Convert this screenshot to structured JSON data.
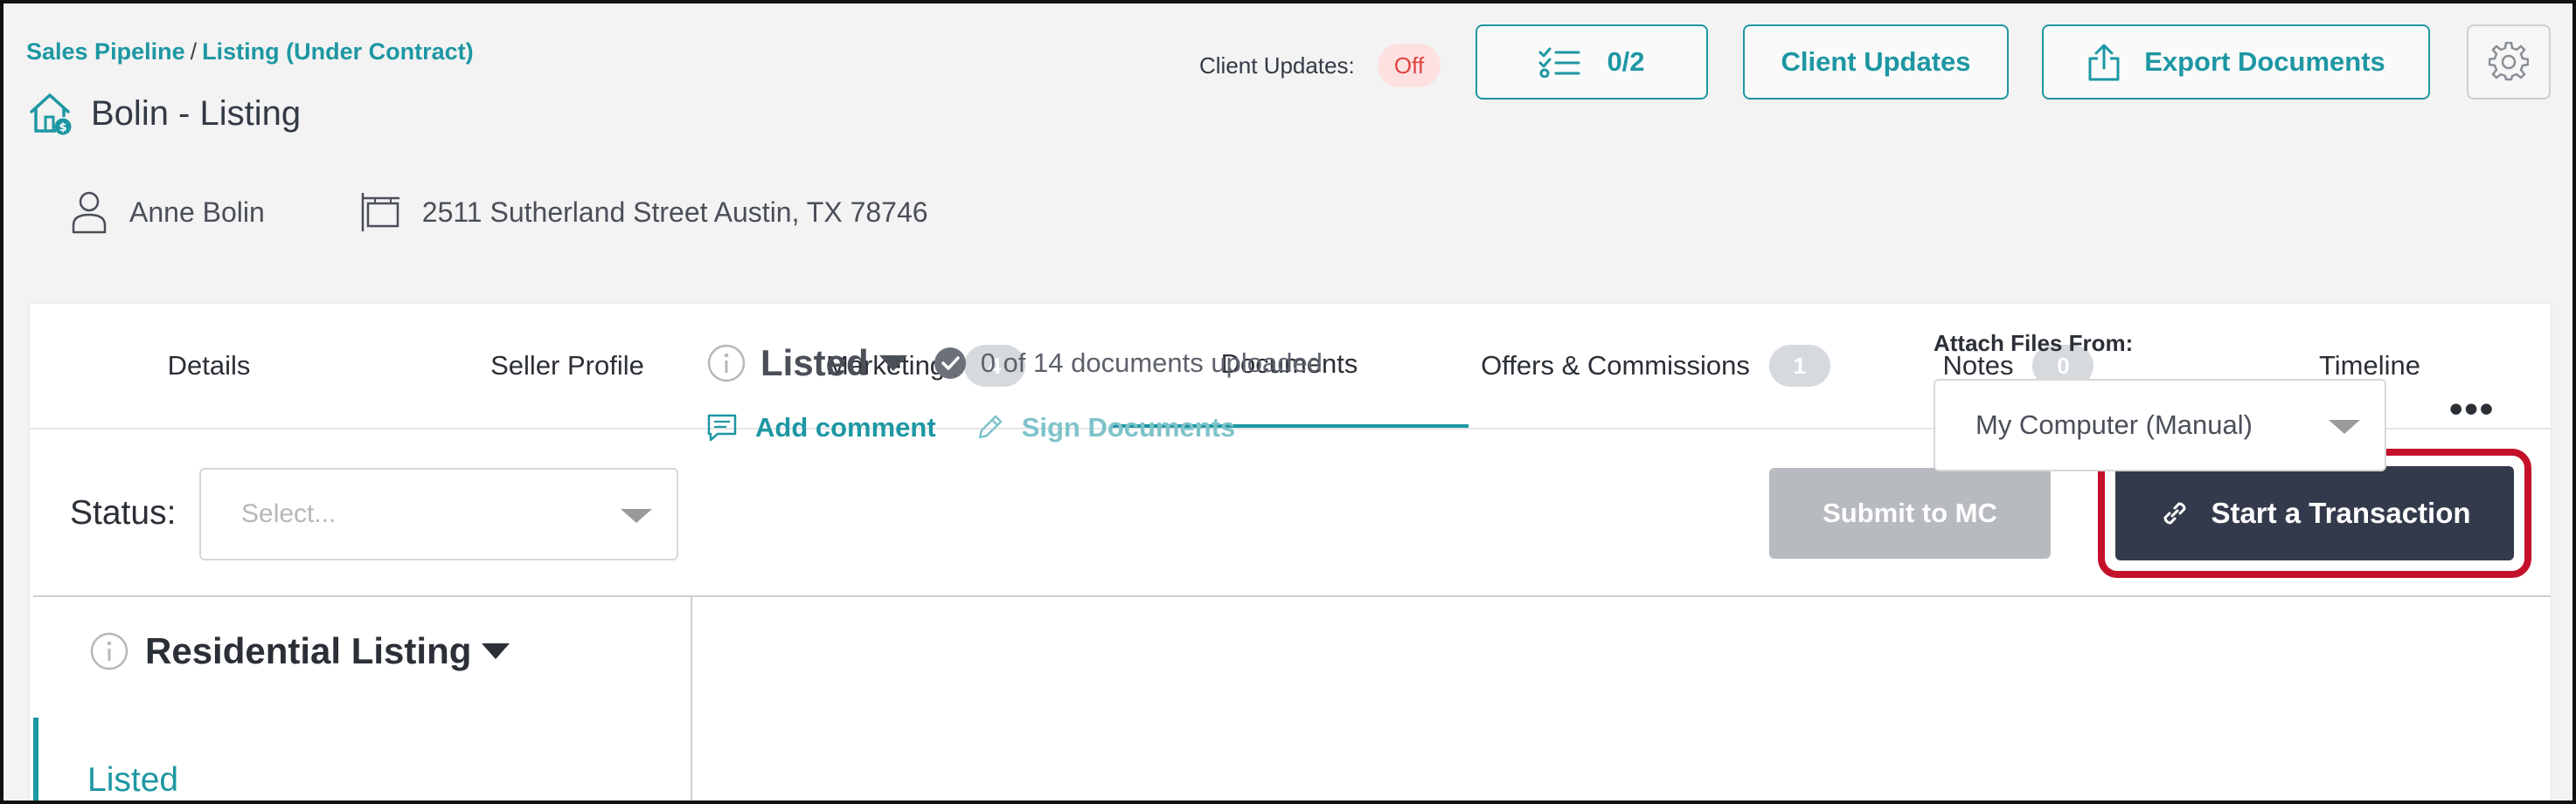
{
  "breadcrumb": {
    "items": [
      "Sales Pipeline",
      "Listing (Under Contract)"
    ],
    "separator": "/"
  },
  "header": {
    "title": "Bolin - Listing",
    "client_updates_label": "Client Updates:",
    "client_updates_status": "Off",
    "tasks_button": "0/2",
    "client_updates_button": "Client Updates",
    "export_button": "Export Documents"
  },
  "info": {
    "contact": "Anne Bolin",
    "address": "2511 Sutherland Street Austin, TX 78746"
  },
  "tabs": [
    {
      "label": "Details",
      "badge": ""
    },
    {
      "label": "Seller Profile",
      "badge": ""
    },
    {
      "label": "Marketing",
      "badge": "4"
    },
    {
      "label": "Documents",
      "badge": "",
      "active": true
    },
    {
      "label": "Offers & Commissions",
      "badge": "1"
    },
    {
      "label": "Notes",
      "badge": "0"
    },
    {
      "label": "Timeline",
      "badge": ""
    }
  ],
  "status": {
    "label": "Status:",
    "placeholder": "Select..."
  },
  "buttons": {
    "submit": "Submit to MC",
    "start_transaction": "Start a Transaction"
  },
  "left_pane": {
    "listing_type": "Residential Listing",
    "nav_item": "Listed"
  },
  "stage": {
    "name": "Listed",
    "docs_status": "0 of 14 documents uploaded",
    "add_comment": "Add comment",
    "sign_documents": "Sign Documents"
  },
  "attach": {
    "label": "Attach Files From:",
    "value": "My Computer (Manual)"
  },
  "more_menu": "•••",
  "colors": {
    "accent": "#1d97a3",
    "dark_button": "#333a4b",
    "highlight_outline": "#c4102a",
    "off_pill_bg": "#fde1e1",
    "off_pill_text": "#e0443f"
  }
}
